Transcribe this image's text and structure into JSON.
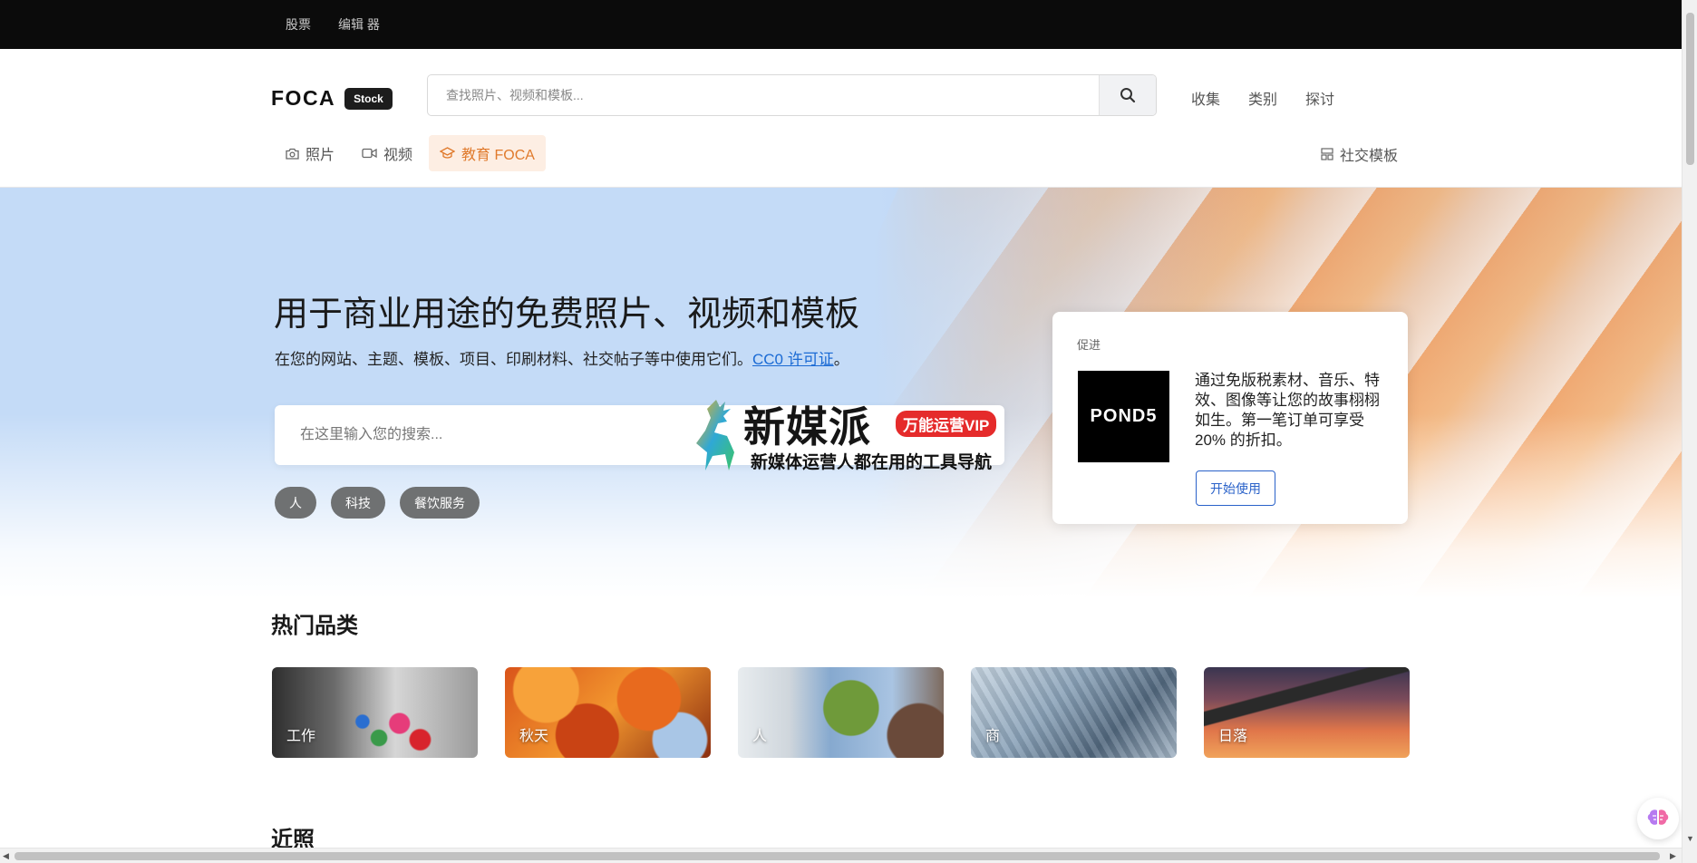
{
  "topbar": {
    "links": [
      "股票",
      "编辑 器"
    ]
  },
  "header": {
    "logo": "FOCA",
    "badge": "Stock",
    "search_placeholder": "查找照片、视频和模板...",
    "nav": [
      "收集",
      "类别",
      "探讨"
    ],
    "tabs": [
      {
        "label": "照片",
        "icon": "camera-icon",
        "active": false
      },
      {
        "label": "视频",
        "icon": "video-icon",
        "active": false
      },
      {
        "label": "教育 FOCA",
        "icon": "graduation-cap-icon",
        "active": true
      }
    ],
    "social": "社交模板"
  },
  "hero": {
    "title": "用于商业用途的免费照片、视频和模板",
    "subtitle": "在您的网站、主题、模板、项目、印刷材料、社交帖子等中使用它们。",
    "license": "CC0 许可证",
    "period": "。",
    "search_placeholder": "在这里输入您的搜索...",
    "pills": [
      "人",
      "科技",
      "餐饮服务"
    ]
  },
  "watermark": {
    "title": "新媒派",
    "vip": "万能运营VIP",
    "subtitle": "新媒体运营人都在用的工具导航"
  },
  "promo": {
    "label": "促进",
    "logo": "POND5",
    "text": "通过免版税素材、音乐、特效、图像等让您的故事栩栩如生。第一笔订单可享受 20% 的折扣。",
    "button": "开始使用"
  },
  "categories_section": {
    "title": "热门品类",
    "items": [
      "工作",
      "秋天",
      "人",
      "商",
      "日落"
    ]
  },
  "recent_section": {
    "title": "近照"
  },
  "colors": {
    "accent": "#e07a2c",
    "link": "#1a6ad4",
    "topbar": "#0b0b0b",
    "pill": "#6f7172"
  }
}
